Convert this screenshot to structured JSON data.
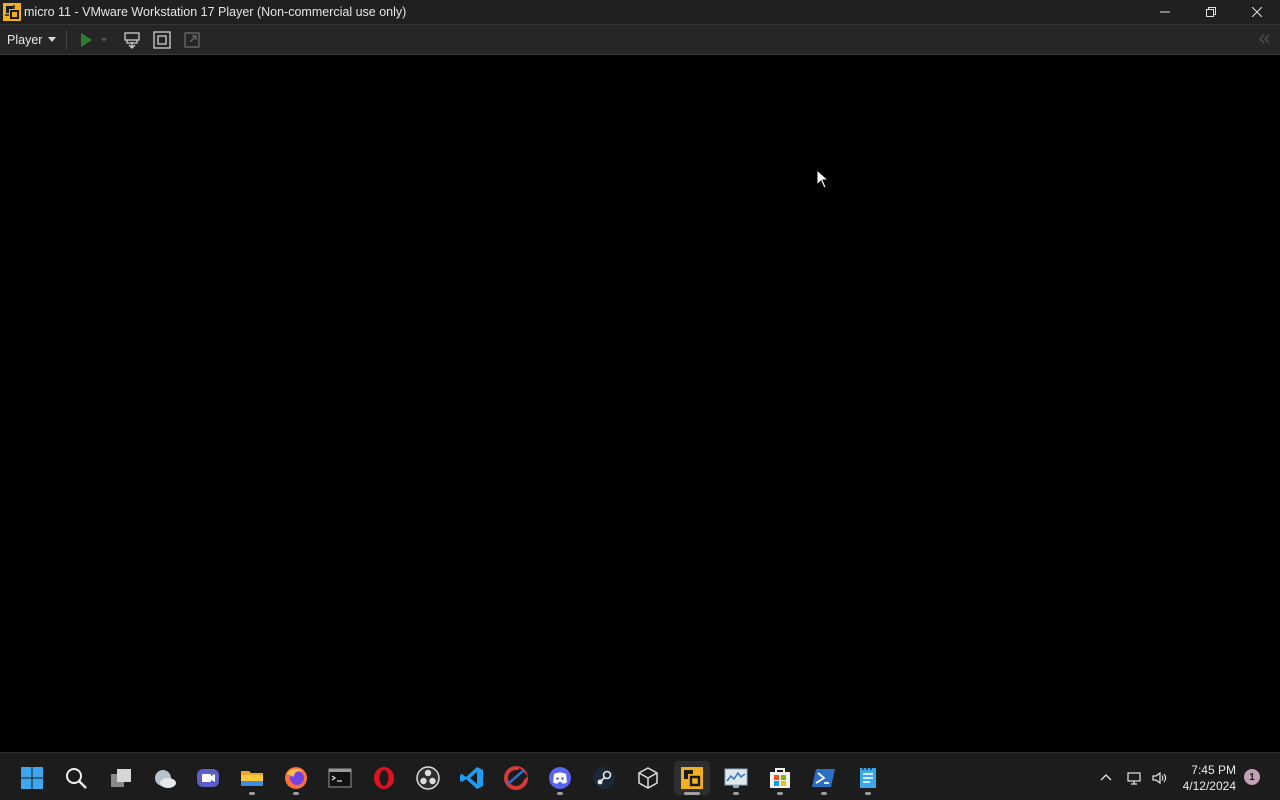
{
  "window": {
    "title": "micro 11 - VMware Workstation 17 Player (Non-commercial use only)",
    "controls": [
      "minimize-icon",
      "restore-icon",
      "close-icon"
    ]
  },
  "toolbar": {
    "player_menu_label": "Player",
    "icons": [
      "play-icon",
      "send-ctrl-alt-del-icon",
      "fullscreen-icon",
      "unity-icon",
      "collapse-icon"
    ]
  },
  "taskbar": {
    "apps": [
      {
        "name": "start",
        "icon": "windows-start-icon"
      },
      {
        "name": "search",
        "icon": "search-icon"
      },
      {
        "name": "task-view",
        "icon": "task-view-icon"
      },
      {
        "name": "widgets",
        "icon": "weather-cloud-icon"
      },
      {
        "name": "teams",
        "icon": "video-chat-icon"
      },
      {
        "name": "file-explorer",
        "icon": "folder-icon"
      },
      {
        "name": "firefox",
        "icon": "firefox-icon"
      },
      {
        "name": "terminal",
        "icon": "terminal-icon"
      },
      {
        "name": "opera",
        "icon": "opera-icon"
      },
      {
        "name": "obs",
        "icon": "obs-icon"
      },
      {
        "name": "vscode",
        "icon": "vscode-icon"
      },
      {
        "name": "ccleaner",
        "icon": "ccleaner-icon"
      },
      {
        "name": "discord",
        "icon": "discord-icon"
      },
      {
        "name": "steam",
        "icon": "steam-icon"
      },
      {
        "name": "virtualbox",
        "icon": "cube-icon"
      },
      {
        "name": "vmware",
        "icon": "vmware-icon"
      },
      {
        "name": "resource-monitor",
        "icon": "monitor-chart-icon"
      },
      {
        "name": "microsoft-store",
        "icon": "store-icon"
      },
      {
        "name": "powershell",
        "icon": "powershell-icon"
      },
      {
        "name": "notepad",
        "icon": "notepad-icon"
      }
    ],
    "tray": {
      "icons": [
        "chevron-up-icon",
        "network-icon",
        "volume-icon"
      ],
      "time": "7:45 PM",
      "date": "4/12/2024",
      "notification_count": "1"
    }
  },
  "colors": {
    "titlebar": "#202020",
    "toolbar": "#262626",
    "vm_background": "#000000",
    "taskbar": "#1c1c1c",
    "play_green": "#3fae3f"
  }
}
